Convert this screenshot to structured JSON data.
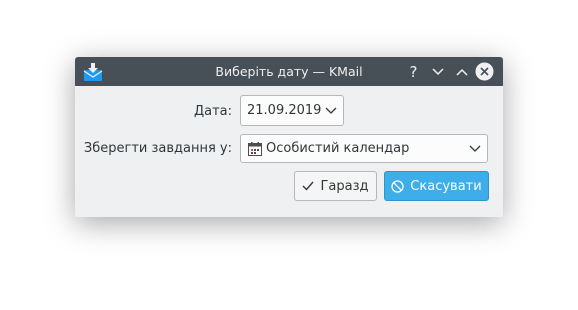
{
  "window": {
    "title": "Виберіть дату — KMail",
    "help_glyph": "?"
  },
  "form": {
    "date_label": "Дата:",
    "date_value": "21.09.2019",
    "save_label": "Зберегти завдання у:",
    "calendar_value": "Особистий календар"
  },
  "buttons": {
    "ok_label": "Гаразд",
    "cancel_label": "Скасувати"
  },
  "colors": {
    "titlebar": "#475057",
    "window_bg": "#eff0f1",
    "accent": "#3daee9",
    "text": "#31363b"
  },
  "icons": {
    "app": "kmail-envelope-icon",
    "calendar": "calendar-icon",
    "ok": "checkmark-icon",
    "cancel": "cancel-icon"
  }
}
